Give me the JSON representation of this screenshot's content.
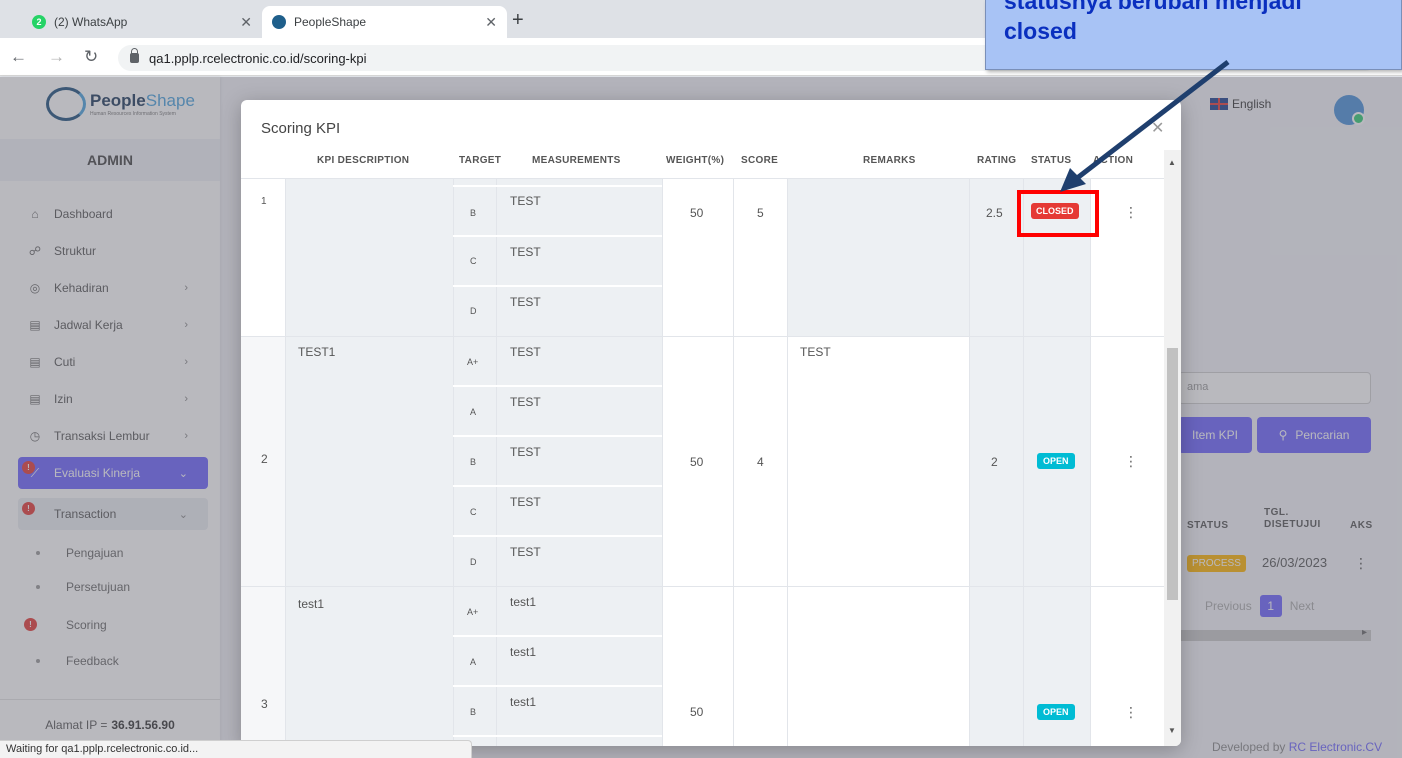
{
  "browser": {
    "tabs": [
      {
        "label": "(2) WhatsApp",
        "badge": "2"
      },
      {
        "label": "PeopleShape"
      }
    ],
    "url": "qa1.pplp.rcelectronic.co.id/scoring-kpi",
    "status_text": "Waiting for qa1.pplp.rcelectronic.co.id..."
  },
  "app": {
    "logo_name_a": "People",
    "logo_name_b": "Shape",
    "logo_sub": "Human Resources Information System",
    "role": "ADMIN",
    "language": "English",
    "menu": [
      {
        "label": "Dashboard",
        "icon": "home-icon"
      },
      {
        "label": "Struktur",
        "icon": "org-chart-icon"
      },
      {
        "label": "Kehadiran",
        "icon": "fingerprint-icon"
      },
      {
        "label": "Jadwal Kerja",
        "icon": "calendar-icon"
      },
      {
        "label": "Cuti",
        "icon": "calendar-icon"
      },
      {
        "label": "Izin",
        "icon": "calendar-icon"
      },
      {
        "label": "Transaksi Lembur",
        "icon": "clock-icon"
      },
      {
        "label": "Evaluasi Kinerja",
        "icon": "chart-icon"
      },
      {
        "label": "Transaction",
        "icon": "circle-icon"
      }
    ],
    "submenu": [
      {
        "label": "Pengajuan"
      },
      {
        "label": "Persetujuan"
      },
      {
        "label": "Scoring"
      },
      {
        "label": "Feedback"
      }
    ],
    "ip_label": "Alamat IP  =",
    "ip_value": "36.91.56.90",
    "bg": {
      "search_placeholder": "ama",
      "btn_item_kpi": "Item KPI",
      "btn_search": "Pencarian",
      "col_status": "STATUS",
      "col_tgl": "TGL.",
      "col_disetujui": "DISETUJUI",
      "col_aksi": "AKS",
      "process_badge": "PROCESS",
      "date": "26/03/2023",
      "prev": "Previous",
      "page": "1",
      "next": "Next"
    },
    "developed_by": "Developed by",
    "developer": "RC Electronic.CV"
  },
  "modal": {
    "title": "Scoring KPI",
    "headers": {
      "desc": "KPI DESCRIPTION",
      "target": "TARGET",
      "measure": "MEASUREMENTS",
      "weight": "WEIGHT(%)",
      "score": "SCORE",
      "remarks": "REMARKS",
      "rating": "RATING",
      "status": "STATUS",
      "action": "ACTION"
    },
    "rows": [
      {
        "no": "1",
        "desc": "",
        "targets": [
          "B",
          "C",
          "D"
        ],
        "measures": [
          "TEST",
          "TEST",
          "TEST"
        ],
        "weight": "50",
        "score": "5",
        "remarks": "",
        "rating": "2.5",
        "status": "CLOSED"
      },
      {
        "no": "2",
        "desc": "TEST1",
        "targets": [
          "A+",
          "A",
          "B",
          "C",
          "D"
        ],
        "measures": [
          "TEST",
          "TEST",
          "TEST",
          "TEST",
          "TEST"
        ],
        "weight": "50",
        "score": "4",
        "remarks": "TEST",
        "rating": "2",
        "status": "OPEN"
      },
      {
        "no": "3",
        "desc": "test1",
        "targets": [
          "A+",
          "A",
          "B"
        ],
        "measures": [
          "test1",
          "test1",
          "test1"
        ],
        "weight": "50",
        "score": "",
        "remarks": "",
        "rating": "",
        "status": "OPEN"
      }
    ]
  },
  "annotation": {
    "line1": "statusnya berubah menjadi",
    "line2": "closed"
  }
}
